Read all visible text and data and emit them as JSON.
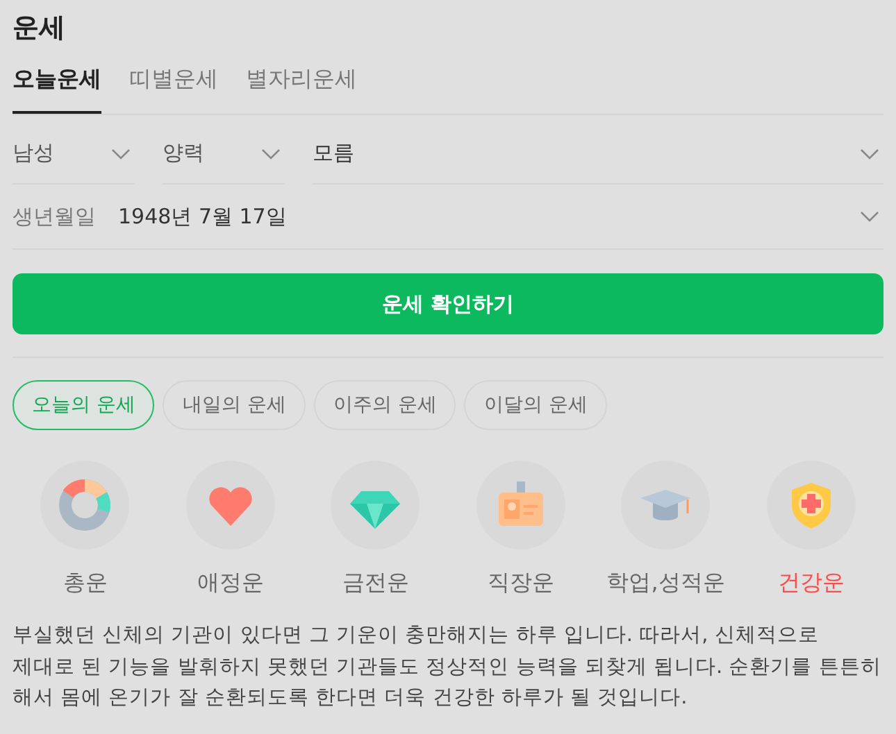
{
  "title": "운세",
  "tabs": [
    {
      "label": "오늘운세",
      "selected": true
    },
    {
      "label": "띠별운세",
      "selected": false
    },
    {
      "label": "별자리운세",
      "selected": false
    }
  ],
  "selects": [
    {
      "value": "남성"
    },
    {
      "value": "양력"
    },
    {
      "value": "모름"
    }
  ],
  "birth": {
    "label": "생년월일",
    "value": "1948년 7월 17일"
  },
  "button": "운세 확인하기",
  "periods": [
    {
      "label": "오늘의 운세",
      "selected": true
    },
    {
      "label": "내일의 운세",
      "selected": false
    },
    {
      "label": "이주의 운세",
      "selected": false
    },
    {
      "label": "이달의 운세",
      "selected": false
    }
  ],
  "categories": [
    {
      "label": "총운",
      "kind": "donut",
      "selected": false
    },
    {
      "label": "애정운",
      "kind": "heart",
      "selected": false
    },
    {
      "label": "금전운",
      "kind": "gem",
      "selected": false
    },
    {
      "label": "직장운",
      "kind": "badge",
      "selected": false
    },
    {
      "label": "학업,성적운",
      "kind": "cap",
      "selected": false
    },
    {
      "label": "건강운",
      "kind": "shield",
      "selected": true
    }
  ],
  "text": "부실했던 신체의 기관이 있다면 그 기운이 충만해지는 하루 입니다. 따라서, 신체적으로 제대로 된 기능을 발휘하지 못했던 기관들도 정상적인 능력을 되찾게 됩니다. 순환기를 튼튼히 해서 몸에 온기가 잘 순환되도록 한다면 더욱 건강한 하루가 될 것입니다."
}
